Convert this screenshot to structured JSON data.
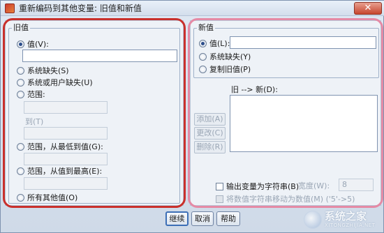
{
  "window": {
    "title": "重新编码到其他变量: 旧值和新值",
    "close_label": "✕"
  },
  "old_value": {
    "legend": "旧值",
    "value_label": "值(V):",
    "value_input": "",
    "system_missing_label": "系统缺失(S)",
    "system_or_user_missing_label": "系统或用户缺失(U)",
    "range_label": "范围:",
    "range_to_label": "到(T)",
    "range_lowest_label": "范围，从最低到值(G):",
    "range_highest_label": "范围，从值到最高(E):",
    "all_other_label": "所有其他值(O)",
    "selected": "value"
  },
  "new_value": {
    "legend": "新值",
    "value_label": "值(L):",
    "value_input": "",
    "system_missing_label": "系统缺失(Y)",
    "copy_old_label": "复制旧值(P)",
    "selected": "value"
  },
  "mapping": {
    "list_label": "旧 --> 新(D):",
    "add_label": "添加(A)",
    "change_label": "更改(C)",
    "remove_label": "删除(R)"
  },
  "options": {
    "output_string_label": "输出变量为字符串(B)",
    "width_label": "宽度(W):",
    "width_value": "8",
    "numeric_string_label": "将数值字符串移动为数值(M) ('5'->5)"
  },
  "buttons": {
    "continue_label": "继续",
    "cancel_label": "取消",
    "help_label": "帮助"
  },
  "watermark": {
    "main": "系统之家",
    "sub": "XITONGZHIJIA.NET"
  }
}
